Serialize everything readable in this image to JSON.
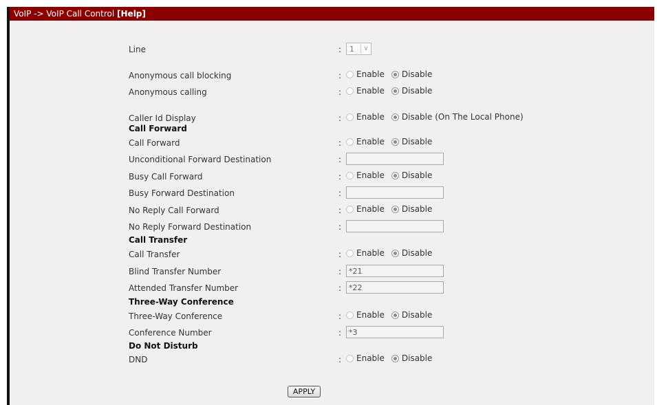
{
  "header": {
    "title": "VoIP -> VoIP Call Control ",
    "help_label": "[Help]"
  },
  "colon": ":",
  "line": {
    "label": "Line",
    "value": "1"
  },
  "radio_labels": {
    "enable": "Enable",
    "disable": "Disable"
  },
  "anonymous_call_blocking": {
    "label": "Anonymous call blocking",
    "selected": "Disable"
  },
  "anonymous_calling": {
    "label": "Anonymous calling",
    "selected": "Disable"
  },
  "caller_id_display": {
    "label": "Caller Id Display",
    "disable_label": "Disable (On The Local Phone)",
    "selected": "Disable"
  },
  "call_forward": {
    "section": "Call Forward",
    "call_forward_label": "Call Forward",
    "unconditional_dest_label": "Unconditional Forward Destination",
    "unconditional_dest_value": "",
    "busy_forward_label": "Busy Call Forward",
    "busy_dest_label": "Busy Forward Destination",
    "busy_dest_value": "",
    "no_reply_forward_label": "No Reply Call Forward",
    "no_reply_dest_label": "No Reply Forward Destination",
    "no_reply_dest_value": ""
  },
  "call_transfer": {
    "section": "Call Transfer",
    "call_transfer_label": "Call Transfer",
    "blind_label": "Blind Transfer Number",
    "blind_value": "*21",
    "attended_label": "Attended Transfer Number",
    "attended_value": "*22"
  },
  "three_way": {
    "section": "Three-Way Conference",
    "three_way_label": "Three-Way Conference",
    "conference_number_label": "Conference Number",
    "conference_number_value": "*3"
  },
  "dnd": {
    "section": "Do Not Disturb",
    "dnd_label": "DND"
  },
  "apply_label": "APPLY",
  "colors": {
    "title_bar": "#8b0000",
    "panel_bg": "#f1efef"
  }
}
